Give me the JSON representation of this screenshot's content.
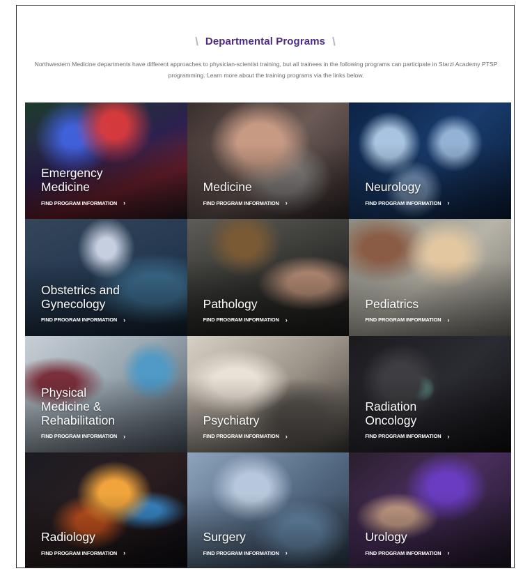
{
  "section": {
    "title": "Departmental Programs",
    "intro": "Northwestern Medicine departments have different approaches to physician-scientist training, but all trainees in the following programs can participate in Starzl Academy PTSP programming. Learn more about the training programs via the links below."
  },
  "link_label": "FIND PROGRAM INFORMATION",
  "programs": [
    {
      "label": "Emergency\nMedicine"
    },
    {
      "label": "Medicine"
    },
    {
      "label": "Neurology"
    },
    {
      "label": "Obstetrics and\nGynecology"
    },
    {
      "label": "Pathology"
    },
    {
      "label": "Pediatrics"
    },
    {
      "label": "Physical\nMedicine &\nRehabilitation"
    },
    {
      "label": "Psychiatry"
    },
    {
      "label": "Radiation\nOncology"
    },
    {
      "label": "Radiology"
    },
    {
      "label": "Surgery"
    },
    {
      "label": "Urology"
    }
  ],
  "colors": {
    "title": "#4e2a84",
    "text": "#6b6b6b"
  }
}
